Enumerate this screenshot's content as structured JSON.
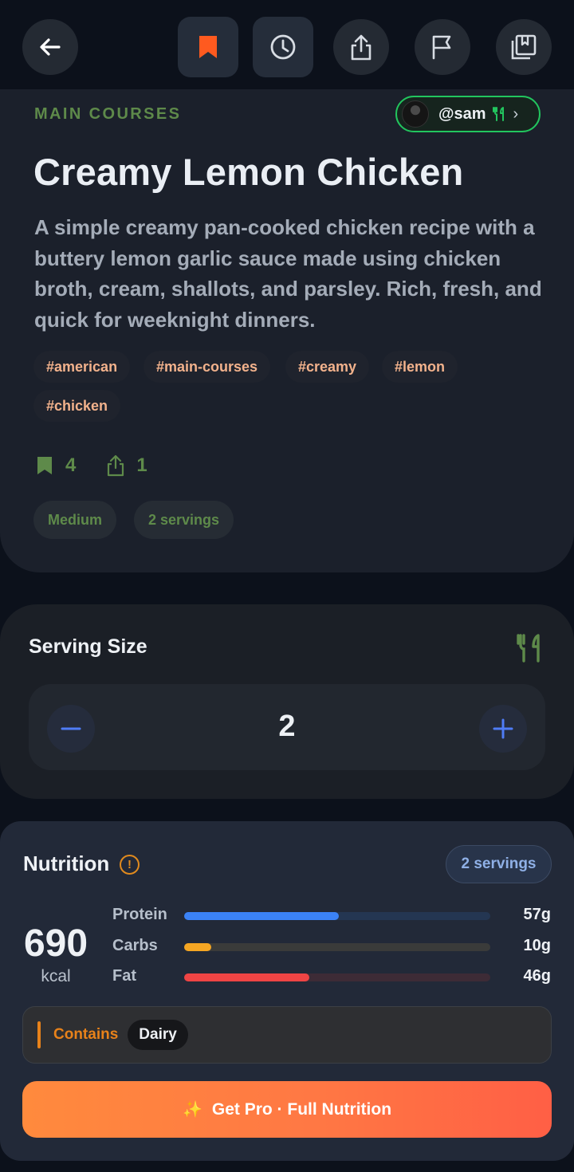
{
  "toolbar": {
    "back_icon": "arrow-left-icon",
    "bookmark_icon": "bookmark-icon",
    "history_icon": "clock-icon",
    "share_icon": "share-icon",
    "report_icon": "flag-icon",
    "collection_icon": "collection-icon",
    "accent": "#ff5a1f"
  },
  "recipe": {
    "category": "MAIN COURSES",
    "author": "@sam",
    "title": "Creamy Lemon Chicken",
    "description": "A simple creamy pan-cooked chicken recipe with a buttery lemon garlic sauce made using chicken broth, cream, shallots, and parsley. Rich, fresh, and quick for weeknight dinners.",
    "tags": [
      "#american",
      "#main-courses",
      "#creamy",
      "#lemon",
      "#chicken"
    ],
    "bookmarks": "4",
    "shares": "1",
    "difficulty": "Medium",
    "servings_label": "2 servings"
  },
  "serving_size": {
    "title": "Serving Size",
    "value": "2"
  },
  "nutrition": {
    "title": "Nutrition",
    "info_icon_text": "!",
    "servings_badge": "2 servings",
    "kcal": "690",
    "kcal_unit": "kcal",
    "macros": [
      {
        "label": "Protein",
        "value": "57g",
        "fill": 0.505,
        "color": "#3b82f6",
        "track": "#243652"
      },
      {
        "label": "Carbs",
        "value": "10g",
        "fill": 0.088,
        "color": "#f5a623",
        "track": "#3a3b3a"
      },
      {
        "label": "Fat",
        "value": "46g",
        "fill": 0.408,
        "color": "#ef4444",
        "track": "#3d2b36"
      }
    ],
    "allergen_label": "Contains",
    "allergen_value": "Dairy",
    "pro_button": "Get Pro · Full Nutrition",
    "pro_icon": "✨"
  }
}
